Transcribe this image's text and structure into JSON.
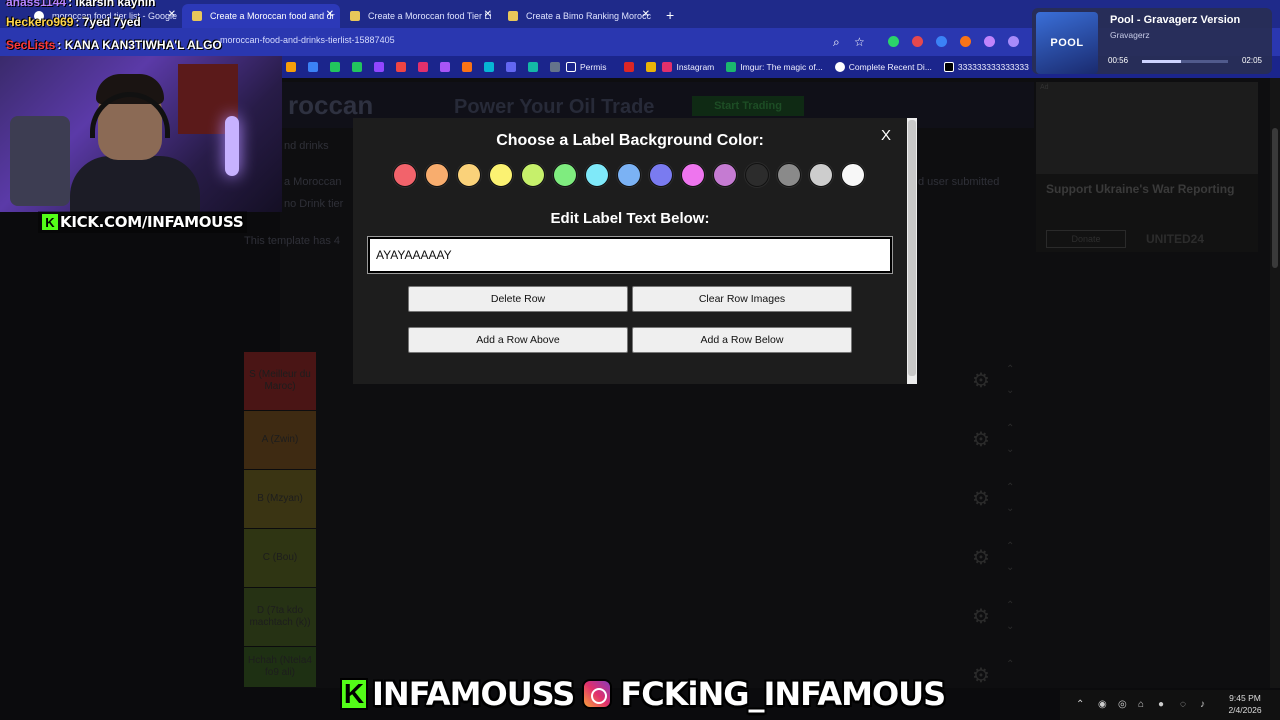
{
  "browser": {
    "tabs": [
      {
        "label": "moroccan food tier list - Google",
        "active": false
      },
      {
        "label": "Create a Moroccan food and dr",
        "active": true
      },
      {
        "label": "Create a Moroccan food Tier Li",
        "active": false
      },
      {
        "label": "Create a Bimo Ranking Morocc",
        "active": false
      }
    ],
    "new_tab_glyph": "+",
    "close_glyph": "✕",
    "url": "moroccan-food-and-drinks-tierlist-15887405",
    "bookmarks": [
      {
        "label": "Permis",
        "color": "#f2c94c"
      },
      {
        "label": "Instagram",
        "color": "#e1306c"
      },
      {
        "label": "Imgur: The magic of...",
        "color": "#1bb76e"
      },
      {
        "label": "Complete Recent Di...",
        "color": "#ffffff"
      },
      {
        "label": "333333333333333",
        "color": "#ffffff"
      }
    ]
  },
  "chat": [
    {
      "user": "anass1144",
      "user_color": "#b784ff",
      "message": ": ikarsin kaynin"
    },
    {
      "user": "Heckero969",
      "user_color": "#ffd54a",
      "message": ": 7yed 7yed"
    },
    {
      "user": "SecLists",
      "user_color": "#ff3b3b",
      "message": ": KANA KAN3TIWHA'L ALGO"
    }
  ],
  "kick_badge": {
    "text": "KICK.COM/INFAMOUSS",
    "k": "K"
  },
  "music": {
    "album_label": "POOL",
    "title": "Pool - Gravagerz Version",
    "artist": "Gravagerz",
    "time_current": "00:56",
    "time_total": "02:05",
    "progress": 0.45
  },
  "background_page": {
    "banner_brand": "roccan",
    "banner_ad": "Power Your Oil Trade",
    "banner_cta": "Start Trading",
    "intro_1": "nd drinks",
    "intro_2": "a Moroccan",
    "intro_3": "no Drink tier",
    "intro_4": "This template has 4",
    "intro_right": "d user submitted",
    "side_ad_title": "Support Ukraine's War Reporting",
    "side_ad_button": "Donate",
    "side_ad_brand": "UNITED24",
    "side_ad_tag": "Ad"
  },
  "tier_rows": [
    {
      "label": "S (Meilleur du Maroc)",
      "color": "#4a1515"
    },
    {
      "label": "A (Zwin)",
      "color": "#3e2a12"
    },
    {
      "label": "B (Mzyan)",
      "color": "#3a3413"
    },
    {
      "label": "C (Bou)",
      "color": "#2f3513"
    },
    {
      "label": "D (7ta kdo machtach (k))",
      "color": "#263214"
    },
    {
      "label": "Hchah (Ntela4 fo9 ali)",
      "color": "#1e3013"
    }
  ],
  "row_icons": {
    "gear": "⚙",
    "up": "⌃",
    "down": "⌄"
  },
  "modal": {
    "color_title": "Choose a Label Background Color:",
    "close": "X",
    "swatches": [
      "#f2636b",
      "#f8ad6e",
      "#fad27a",
      "#fbf272",
      "#c6f06b",
      "#7fec7f",
      "#7fe9f9",
      "#7bb2f4",
      "#7a7bf0",
      "#ee75ee",
      "#c57bd2",
      "#2c2c2c",
      "#8a8a8a",
      "#cdcdcd",
      "#f7f7f7"
    ],
    "edit_title": "Edit Label Text Below:",
    "input_value": "AYAYAAAAAY",
    "buttons": {
      "delete_row": "Delete Row",
      "clear_images": "Clear Row Images",
      "add_above": "Add a Row Above",
      "add_below": "Add a Row Below"
    }
  },
  "footer_banner": {
    "kick_k": "K",
    "kick_name": "INFAMOUSS",
    "instagram": "FCKiNG_INFAMOUS"
  },
  "taskbar": {
    "time": "9:45 PM",
    "date": "2/4/2026"
  }
}
